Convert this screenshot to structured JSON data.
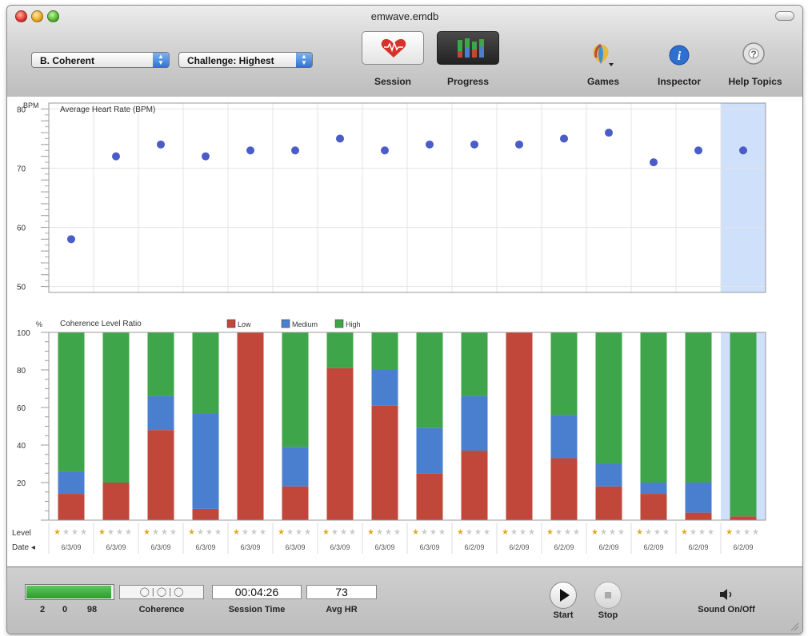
{
  "window": {
    "title": "emwave.emdb"
  },
  "toolbar": {
    "user_select": "B. Coherent",
    "challenge_select": "Challenge: Highest",
    "session_label": "Session",
    "progress_label": "Progress",
    "games_label": "Games",
    "inspector_label": "Inspector",
    "help_label": "Help Topics"
  },
  "hr_chart": {
    "title": "Average Heart Rate (BPM)",
    "unit": "BPM",
    "yticks": [
      "80",
      "70",
      "60",
      "50"
    ]
  },
  "coh_chart": {
    "title": "Coherence Level Ratio",
    "unit": "%",
    "yticks": [
      "100",
      "80",
      "60",
      "40",
      "20"
    ],
    "legend": [
      {
        "label": "Low",
        "color": "#c0473a"
      },
      {
        "label": "Medium",
        "color": "#4a7fd0"
      },
      {
        "label": "High",
        "color": "#3fa54a"
      }
    ],
    "level_label": "Level",
    "date_label": "Date"
  },
  "chart_data": [
    {
      "type": "scatter",
      "title": "Average Heart Rate (BPM)",
      "ylabel": "BPM",
      "ylim": [
        49,
        81
      ],
      "values": [
        58,
        72,
        74,
        72,
        73,
        73,
        75,
        73,
        74,
        74,
        74,
        75,
        76,
        71,
        73,
        73
      ],
      "selected_index": 15
    },
    {
      "type": "bar",
      "stacked": true,
      "title": "Coherence Level Ratio",
      "ylabel": "%",
      "ylim": [
        0,
        100
      ],
      "categories": [
        "6/3/09",
        "6/3/09",
        "6/3/09",
        "6/3/09",
        "6/3/09",
        "6/3/09",
        "6/3/09",
        "6/3/09",
        "6/3/09",
        "6/2/09",
        "6/2/09",
        "6/2/09",
        "6/2/09",
        "6/2/09",
        "6/2/09",
        "6/2/09"
      ],
      "series": [
        {
          "name": "Low",
          "values": [
            14,
            20,
            48,
            6,
            100,
            18,
            81,
            61,
            25,
            37,
            100,
            33,
            18,
            14,
            4,
            2
          ]
        },
        {
          "name": "Medium",
          "values": [
            12,
            0,
            18,
            51,
            0,
            21,
            0,
            19,
            24,
            29,
            0,
            23,
            12,
            6,
            16,
            0
          ]
        },
        {
          "name": "High",
          "values": [
            74,
            80,
            34,
            43,
            0,
            61,
            19,
            20,
            51,
            34,
            0,
            44,
            70,
            80,
            80,
            98
          ]
        }
      ],
      "level_stars": [
        1,
        1,
        1,
        1,
        1,
        1,
        1,
        1,
        1,
        1,
        1,
        1,
        1,
        1,
        1,
        1
      ],
      "selected_index": 15
    }
  ],
  "status": {
    "coherence_values": [
      "2",
      "0",
      "98"
    ],
    "coherence_fraction": 0.98,
    "coherence_label": "Coherence",
    "coherence_indicator": "◯ | ◯ | ◯",
    "session_time": "00:04:26",
    "session_time_label": "Session Time",
    "avg_hr": "73",
    "avg_hr_label": "Avg HR",
    "start_label": "Start",
    "stop_label": "Stop",
    "sound_label": "Sound On/Off"
  }
}
